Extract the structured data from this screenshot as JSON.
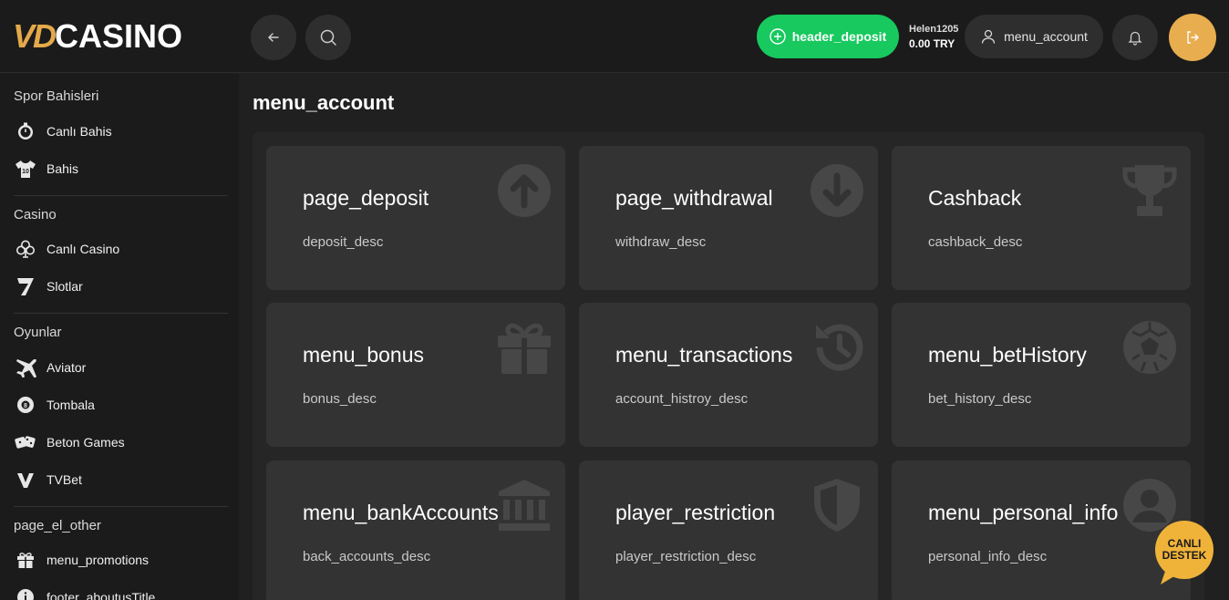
{
  "header": {
    "logo_vd": "VD",
    "logo_casino": "CASINO",
    "deposit_label": "header_deposit",
    "username": "Helen1205",
    "balance": "0.00 TRY",
    "account_label": "menu_account"
  },
  "sidebar": {
    "sections": [
      {
        "title": "Spor Bahisleri",
        "items": [
          {
            "label": "Canlı Bahis",
            "icon": "stopwatch-icon"
          },
          {
            "label": "Bahis",
            "icon": "jersey-icon"
          }
        ]
      },
      {
        "title": "Casino",
        "items": [
          {
            "label": "Canlı Casino",
            "icon": "club-icon"
          },
          {
            "label": "Slotlar",
            "icon": "seven-icon"
          }
        ]
      },
      {
        "title": "Oyunlar",
        "items": [
          {
            "label": "Aviator",
            "icon": "plane-icon"
          },
          {
            "label": "Tombala",
            "icon": "ball-icon"
          },
          {
            "label": "Beton Games",
            "icon": "dice-icon"
          },
          {
            "label": "TVBet",
            "icon": "tvbet-icon"
          }
        ]
      },
      {
        "title": "page_el_other",
        "items": [
          {
            "label": "menu_promotions",
            "icon": "gift-icon"
          },
          {
            "label": "footer_aboutusTitle",
            "icon": "info-icon"
          }
        ]
      }
    ]
  },
  "main": {
    "title": "menu_account",
    "cards": [
      {
        "title": "page_deposit",
        "desc": "deposit_desc",
        "icon": "arrow-up-circle-icon"
      },
      {
        "title": "page_withdrawal",
        "desc": "withdraw_desc",
        "icon": "arrow-down-circle-icon"
      },
      {
        "title": "Cashback",
        "desc": "cashback_desc",
        "icon": "trophy-icon"
      },
      {
        "title": "menu_bonus",
        "desc": "bonus_desc",
        "icon": "gift-icon"
      },
      {
        "title": "menu_transactions",
        "desc": "account_histroy_desc",
        "icon": "history-icon"
      },
      {
        "title": "menu_betHistory",
        "desc": "bet_history_desc",
        "icon": "football-icon"
      },
      {
        "title": "menu_bankAccounts",
        "desc": "back_accounts_desc",
        "icon": "bank-icon"
      },
      {
        "title": "player_restriction",
        "desc": "player_restriction_desc",
        "icon": "shield-icon"
      },
      {
        "title": "menu_personal_info",
        "desc": "personal_info_desc",
        "icon": "user-circle-icon"
      }
    ]
  },
  "support": {
    "line1": "CANLI",
    "line2": "DESTEK"
  },
  "colors": {
    "accent": "#e8ad4e",
    "deposit": "#17c95e",
    "card": "#333333",
    "background": "#202020"
  }
}
